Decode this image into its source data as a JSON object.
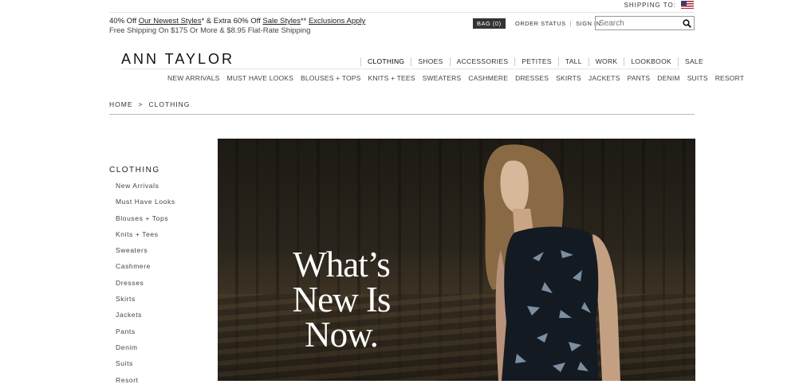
{
  "shipping": {
    "label": "SHIPPING TO:"
  },
  "promo": {
    "prefix": "40% Off ",
    "newest_link": "Our Newest Styles",
    "mid": "* & Extra 60% Off ",
    "sale_link": "Sale Styles",
    "suffix": "** ",
    "exclusions_link": "Exclusions Apply",
    "line2": "Free Shipping On $175 Or More & $8.95 Flat-Rate Shipping"
  },
  "bag": {
    "label": "BAG (0)"
  },
  "account": {
    "order_status": "ORDER STATUS",
    "sep": "|",
    "sign_in": "SIGN IN"
  },
  "search": {
    "placeholder": "Search"
  },
  "brand": {
    "logo": "ANN TAYLOR"
  },
  "main_nav": [
    "CLOTHING",
    "SHOES",
    "ACCESSORIES",
    "PETITES",
    "TALL",
    "WORK",
    "LOOKBOOK",
    "SALE"
  ],
  "sub_nav": [
    "NEW ARRIVALS",
    "MUST HAVE LOOKS",
    "BLOUSES + TOPS",
    "KNITS + TEES",
    "SWEATERS",
    "CASHMERE",
    "DRESSES",
    "SKIRTS",
    "JACKETS",
    "PANTS",
    "DENIM",
    "SUITS",
    "RESORT"
  ],
  "breadcrumb": {
    "home": "HOME",
    "sep": ">",
    "current": "CLOTHING"
  },
  "sidebar": {
    "heading": "CLOTHING",
    "items": [
      "New Arrivals",
      "Must Have Looks",
      "Blouses + Tops",
      "Knits + Tees",
      "Sweaters",
      "Cashmere",
      "Dresses",
      "Skirts",
      "Jackets",
      "Pants",
      "Denim",
      "Suits",
      "Resort"
    ]
  },
  "hero": {
    "line1": "What’s",
    "line2": "New Is",
    "line3": "Now."
  }
}
